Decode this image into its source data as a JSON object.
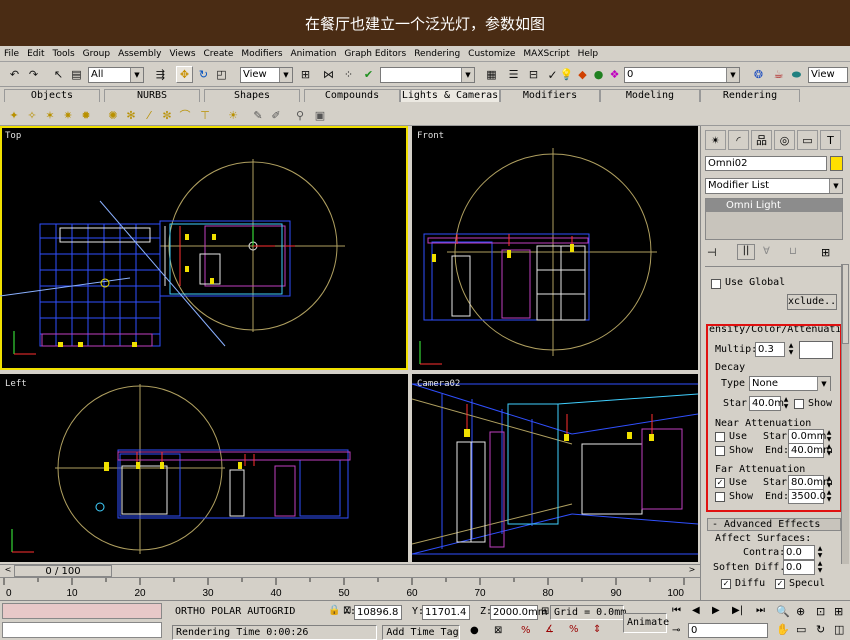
{
  "banner": {
    "text": "在餐厅也建立一个泛光灯，参数如图"
  },
  "menu": [
    "File",
    "Edit",
    "Tools",
    "Group",
    "Views",
    "Create",
    "Modifiers",
    "Animation",
    "Graph Editors",
    "Rendering",
    "Customize",
    "MAXScript",
    "Help"
  ],
  "menu_extra": "Assembly",
  "toolbar": {
    "selection_filter": "All",
    "reference_coord": "View",
    "named_selection": "",
    "layer_value": "0",
    "render_view": "View"
  },
  "tabs": [
    "Objects",
    "NURBS",
    "Shapes",
    "Compounds",
    "Lights & Cameras",
    "Modifiers",
    "Modeling",
    "Rendering"
  ],
  "active_tab": "Lights & Cameras",
  "viewports": {
    "top": "Top",
    "front": "Front",
    "left": "Left",
    "camera": "Camera02"
  },
  "panel": {
    "object_name": "Omni02",
    "object_color": "#ffe000",
    "modifier_list": "Modifier List",
    "stack_item": "Omni Light",
    "use_global": "Use Global",
    "exclude_btn": "xclude..",
    "rollout_title": "ensity/Color/Attenuati",
    "multiplier_label": "Multip:",
    "multiplier": "0.3",
    "decay_label": "Decay",
    "type_label": "Type",
    "type_value": "None",
    "start_label": "Star",
    "start_value": "40.0m",
    "show_label": "Show",
    "near_label": "Near Attenuation",
    "near_use": "Use",
    "near_show": "Show",
    "near_start_label": "Star",
    "near_start": "0.0mm",
    "near_end_label": "End:",
    "near_end": "40.0mm",
    "far_label": "Far Attenuation",
    "far_use": "Use",
    "far_show": "Show",
    "far_start_label": "Star",
    "far_start": "80.0mm",
    "far_end_label": "End:",
    "far_end": "3500.0",
    "adv_title": "- Advanced Effects",
    "affect_surfaces": "Affect Surfaces:",
    "contrast_label": "Contra:",
    "contrast": "0.0",
    "soften_label": "Soften Diff.",
    "soften": "0.0",
    "diffuse": "Diffu",
    "specular": "Specul"
  },
  "time": {
    "frame": "0 / 100",
    "ticks": [
      "0",
      "10",
      "20",
      "30",
      "40",
      "50",
      "60",
      "70",
      "80",
      "90",
      "100"
    ]
  },
  "status": {
    "modes": "ORTHO  POLAR  AUTOGRID",
    "x_label": "X:",
    "x": "10896.8",
    "y_label": "Y:",
    "y": "11701.4",
    "z_label": "Z:",
    "z": "2000.0mm",
    "grid": "Grid = 0.0mm",
    "render_time": "Rendering Time  0:00:26",
    "add_time_tag": "Add Time Tag",
    "animate": "Animate",
    "frame_field": "0"
  }
}
